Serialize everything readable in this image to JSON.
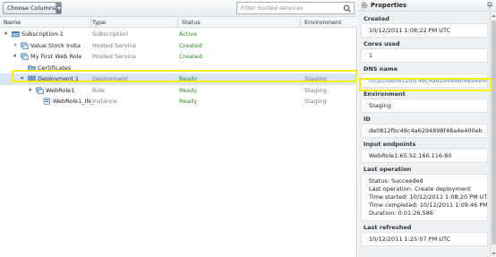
{
  "toolbar": {
    "choose_columns_label": "Choose Columns",
    "filter_placeholder": "Filter hosted services"
  },
  "columns": {
    "name": "Name",
    "type": "Type",
    "status": "Status",
    "environment": "Environment"
  },
  "tree": [
    {
      "name": "Subscription-1",
      "type": "Subscription",
      "status": "Active",
      "environment": "",
      "expander": "open",
      "icon": "subscription-icon"
    },
    {
      "name": "Value Stock India",
      "type": "Hosted Service",
      "status": "Created",
      "environment": "",
      "expander": "closed",
      "icon": "hosted-service-icon"
    },
    {
      "name": "My First Web Role",
      "type": "Hosted Service",
      "status": "Created",
      "environment": "",
      "expander": "open",
      "icon": "hosted-service-icon"
    },
    {
      "name": "Certificates",
      "type": "",
      "status": "",
      "environment": "",
      "expander": "none",
      "icon": "folder-icon"
    },
    {
      "name": "Deployment 1",
      "type": "Deployment",
      "status": "Ready",
      "environment": "Staging",
      "expander": "open",
      "icon": "deployment-icon"
    },
    {
      "name": "WebRole1",
      "type": "Role",
      "status": "Ready",
      "environment": "Staging",
      "expander": "open",
      "icon": "role-icon"
    },
    {
      "name": "WebRole1_IN_",
      "type": "Instance",
      "status": "Ready",
      "environment": "Staging",
      "expander": "none",
      "icon": "instance-icon"
    }
  ],
  "properties": {
    "title": "Properties",
    "created_label": "Created",
    "created_value": "10/12/2011 1:08:22 PM UTC",
    "cores_label": "Cores used",
    "cores_value": "1",
    "dns_label": "DNS name",
    "dns_value": "http://de0812fbc48c4a6294898f48a4e400eb.",
    "environment_label": "Environment",
    "environment_value": "Staging",
    "id_label": "ID",
    "id_value": "de0812fbc48c4a6294898f48a4e400eb",
    "input_label": "Input endpoints",
    "input_value": "WebRole1:65.52.160.116:80",
    "lastop_label": "Last operation",
    "lastop_status": "Status: Succeeded",
    "lastop_operation": "Last operation: Create deployment",
    "lastop_started": "Time started: 10/12/2011 1:08:20 PM UTC",
    "lastop_completed": "Time completed: 10/12/2011 1:09:46 PM UTC",
    "lastop_duration": "Duration: 0:01:26.586",
    "refreshed_label": "Last refreshed",
    "refreshed_value": "10/12/2011 1:25:07 PM UTC"
  },
  "colors": {
    "status_green": "#2e8b22",
    "link_blue": "#3a7fc0",
    "highlight_yellow": "#f5f000",
    "selection_blue": "#d9e6f2"
  }
}
